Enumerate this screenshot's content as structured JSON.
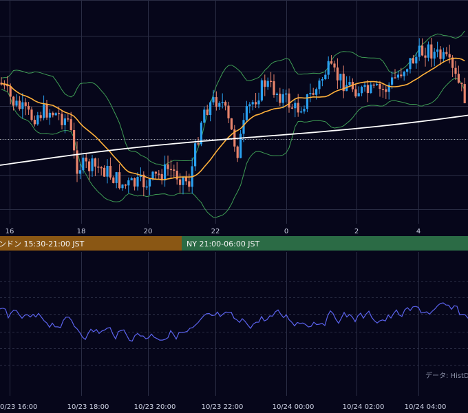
{
  "chart_data": [
    {
      "type": "candlestick",
      "title": "",
      "x_ticks": [
        "16",
        "18",
        "20",
        "22",
        "0",
        "2",
        "4"
      ],
      "colors": {
        "up": "#2aa0f0",
        "down": "#e8846c",
        "sma": "#ffb13b",
        "long_ma": "#ffffff",
        "bollinger": "#3f9e55",
        "grid": "#2a2d44",
        "reference": "#b8b8b8"
      },
      "series": [
        "ローソク足",
        "移動平均",
        "長期移動平均",
        "ボリンジャーバンド"
      ],
      "grid": true
    },
    {
      "type": "line",
      "title": "",
      "x_ticks": [
        "10/23 16:00",
        "10/23 18:00",
        "10/23 20:00",
        "10/23 22:00",
        "10/24 00:00",
        "10/24 02:00",
        "10/24 04:00"
      ],
      "colors": {
        "line": "#5b63ee",
        "grid": "#2a2d44"
      },
      "grid": true
    }
  ],
  "sessions": [
    {
      "label": "ンドン 15:30-21:00 JST",
      "color": "#8a5714"
    },
    {
      "label": "NY 21:00-06:00 JST",
      "color": "#2b6b45"
    }
  ],
  "source_note": "データ: HistDa"
}
